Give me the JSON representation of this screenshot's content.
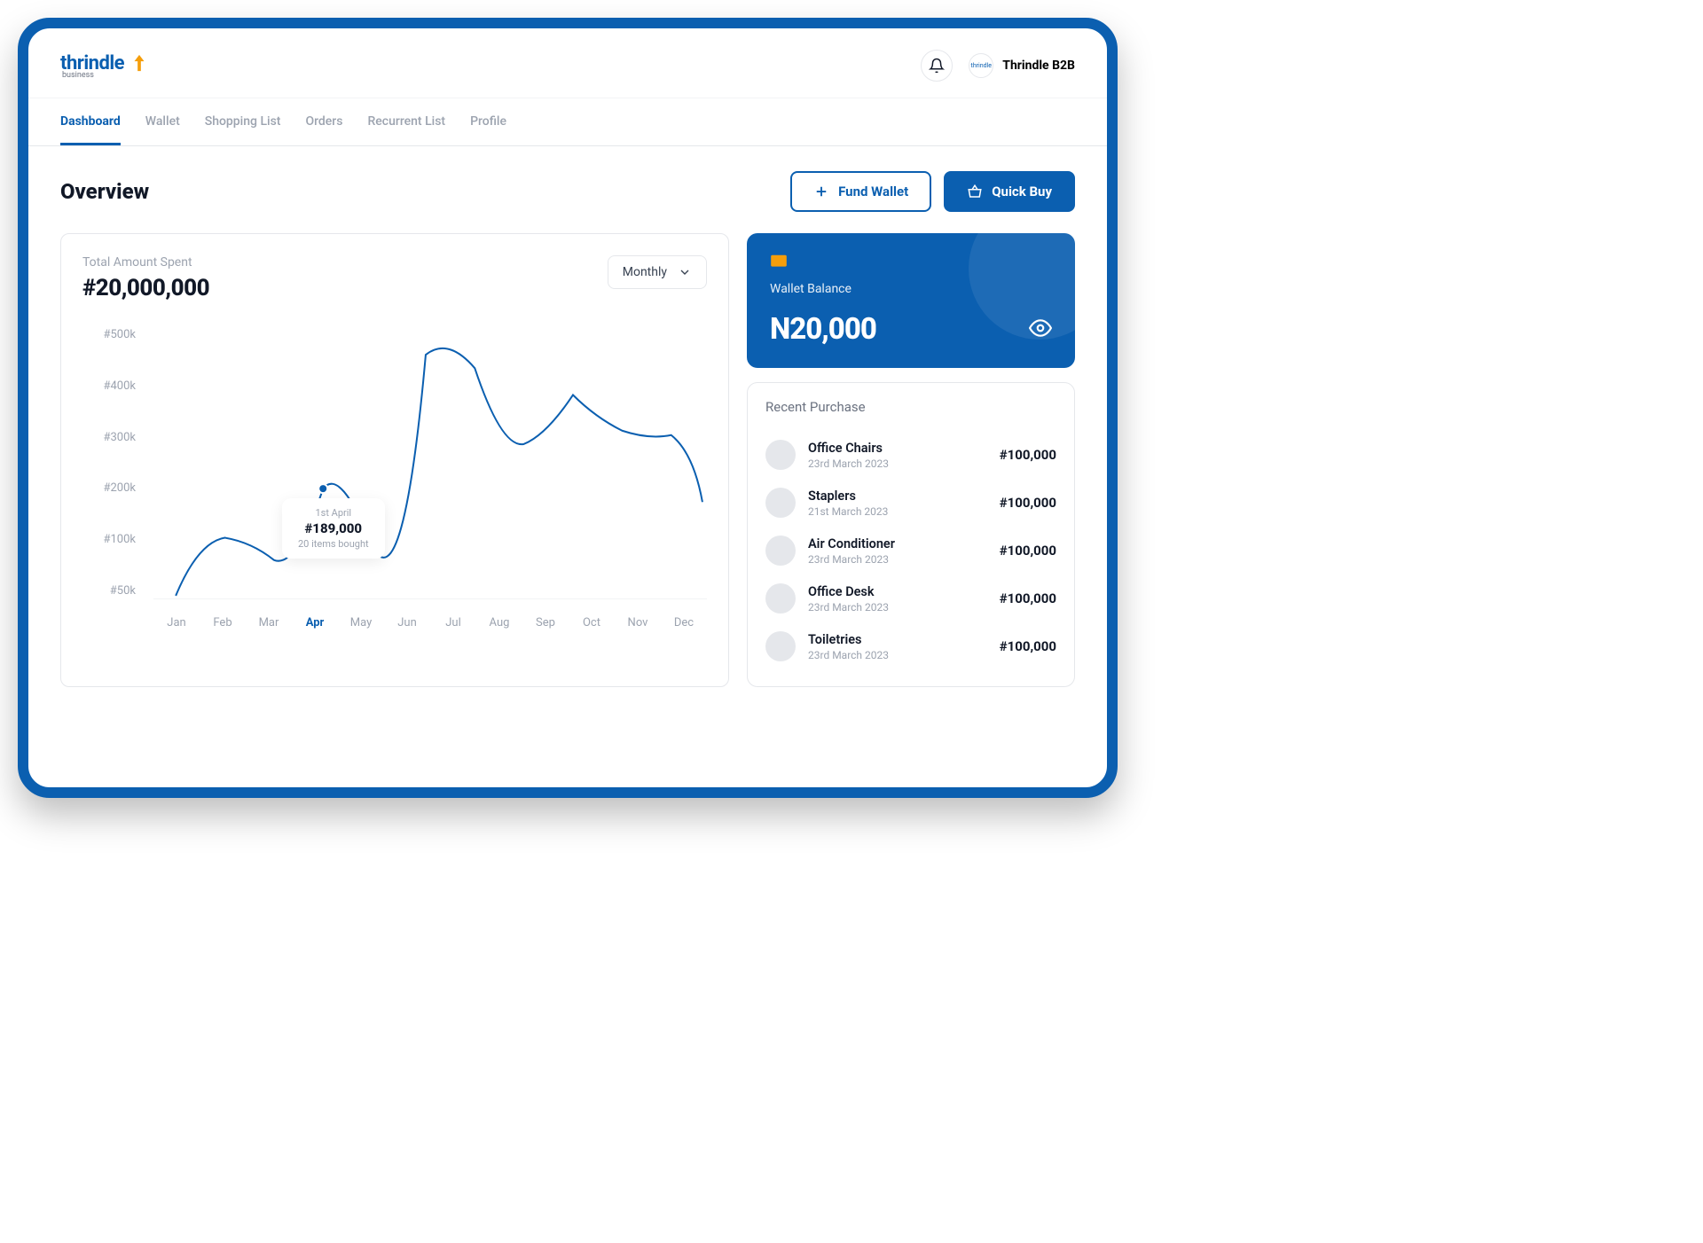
{
  "brand": {
    "name": "thrindle",
    "sub": "business",
    "user_label": "thrindle"
  },
  "header": {
    "user_name": "Thrindle B2B"
  },
  "nav": {
    "items": [
      {
        "label": "Dashboard",
        "active": true
      },
      {
        "label": "Wallet",
        "active": false
      },
      {
        "label": "Shopping List",
        "active": false
      },
      {
        "label": "Orders",
        "active": false
      },
      {
        "label": "Recurrent List",
        "active": false
      },
      {
        "label": "Profile",
        "active": false
      }
    ]
  },
  "page": {
    "title": "Overview"
  },
  "actions": {
    "fund_label": "Fund Wallet",
    "quick_buy_label": "Quick Buy"
  },
  "chart": {
    "label": "Total Amount Spent",
    "amount": "#20,000,000",
    "period": "Monthly",
    "y_ticks": [
      "#500k",
      "#400k",
      "#300k",
      "#200k",
      "#100k",
      "#50k"
    ],
    "x_ticks": [
      "Jan",
      "Feb",
      "Mar",
      "Apr",
      "May",
      "Jun",
      "Jul",
      "Aug",
      "Sep",
      "Oct",
      "Nov",
      "Dec"
    ],
    "active_x": "Apr",
    "tooltip": {
      "date": "1st April",
      "amount": "#189,000",
      "items": "20 items bought"
    }
  },
  "chart_data": {
    "type": "line",
    "title": "Total Amount Spent",
    "xlabel": "",
    "ylabel": "",
    "ylim": [
      50,
      500
    ],
    "categories": [
      "Jan",
      "Feb",
      "Mar",
      "Apr",
      "May",
      "Jun",
      "Jul",
      "Aug",
      "Sep",
      "Oct",
      "Nov",
      "Dec"
    ],
    "values": [
      55,
      100,
      75,
      189,
      120,
      470,
      450,
      320,
      395,
      350,
      335,
      190
    ],
    "unit": "k (₦ thousands)",
    "highlighted_point": {
      "x": "Apr",
      "y": 189,
      "label": "#189,000",
      "note": "20 items bought"
    }
  },
  "wallet": {
    "label": "Wallet Balance",
    "balance": "N20,000"
  },
  "recent": {
    "title": "Recent Purchase",
    "items": [
      {
        "name": "Office Chairs",
        "date": "23rd March 2023",
        "amount": "#100,000"
      },
      {
        "name": "Staplers",
        "date": "21st March 2023",
        "amount": "#100,000"
      },
      {
        "name": "Air Conditioner",
        "date": "23rd March 2023",
        "amount": "#100,000"
      },
      {
        "name": "Office Desk",
        "date": "23rd March 2023",
        "amount": "#100,000"
      },
      {
        "name": "Toiletries",
        "date": "23rd March 2023",
        "amount": "#100,000"
      }
    ]
  }
}
